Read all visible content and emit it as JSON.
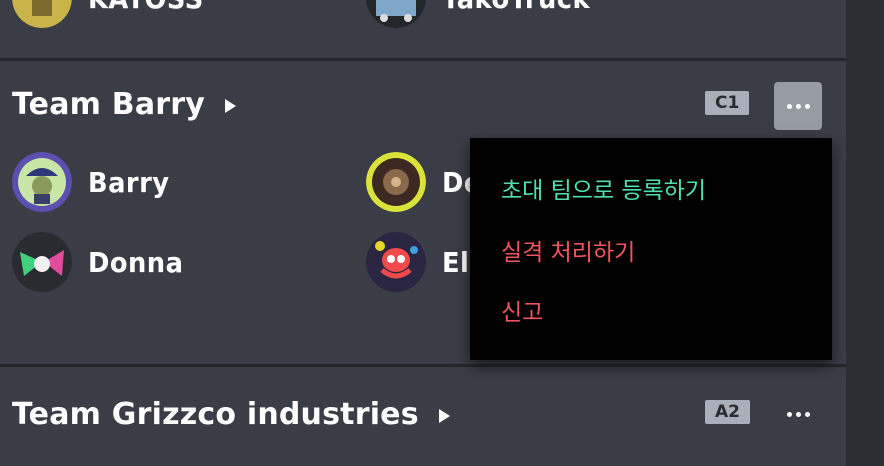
{
  "top_partial": {
    "players": [
      {
        "name": "KAYOSS",
        "avatar_icon": "yellow-character-avatar-icon"
      },
      {
        "name": "TakoTruck",
        "avatar_icon": "truck-character-avatar-icon"
      }
    ]
  },
  "teams": [
    {
      "name": "Team Barry",
      "badge": "C1",
      "players": [
        {
          "name": "Barry",
          "avatar_icon": "pirate-character-avatar-icon"
        },
        {
          "name": "De",
          "avatar_icon": "spiky-character-avatar-icon"
        },
        {
          "name": "Donna",
          "avatar_icon": "squid-ink-avatar-icon"
        },
        {
          "name": "Eli",
          "avatar_icon": "octopus-avatar-icon"
        }
      ]
    },
    {
      "name": "Team Grizzco industries",
      "badge": "A2",
      "players": []
    }
  ],
  "context_menu": {
    "items": [
      {
        "label": "초대 팀으로 등록하기",
        "color": "#4fe0b2"
      },
      {
        "label": "실격 처리하기",
        "color": "#f0545f"
      },
      {
        "label": "신고",
        "color": "#f0545f"
      }
    ]
  },
  "colors": {
    "background": "#3a3d46",
    "badge": "#aab0b9",
    "menu_bg": "#000000",
    "active_button": "#969ba4"
  }
}
